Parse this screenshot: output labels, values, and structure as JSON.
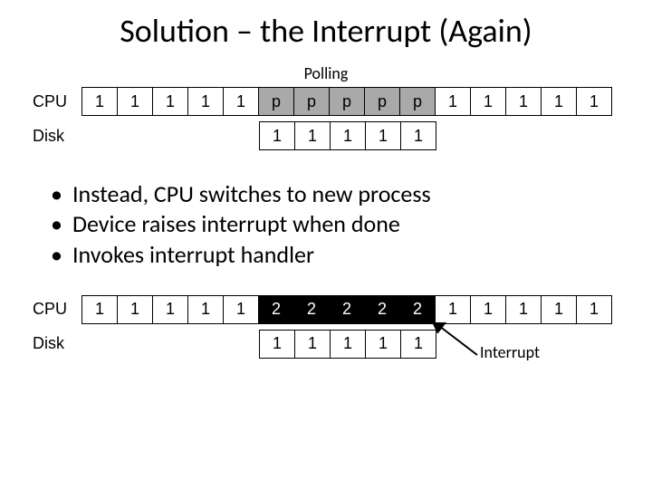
{
  "title": "Solution – the Interrupt (Again)",
  "polling_label": "Polling",
  "interrupt_label": "Interrupt",
  "timeline_polling": {
    "cpu_label": "CPU",
    "disk_label": "Disk",
    "cpu_cells": [
      {
        "t": "1",
        "s": ""
      },
      {
        "t": "1",
        "s": ""
      },
      {
        "t": "1",
        "s": ""
      },
      {
        "t": "1",
        "s": ""
      },
      {
        "t": "1",
        "s": ""
      },
      {
        "t": "p",
        "s": "grey"
      },
      {
        "t": "p",
        "s": "grey"
      },
      {
        "t": "p",
        "s": "grey"
      },
      {
        "t": "p",
        "s": "grey"
      },
      {
        "t": "p",
        "s": "grey"
      },
      {
        "t": "1",
        "s": ""
      },
      {
        "t": "1",
        "s": ""
      },
      {
        "t": "1",
        "s": ""
      },
      {
        "t": "1",
        "s": ""
      },
      {
        "t": "1",
        "s": ""
      }
    ],
    "disk_offset_cells": 5,
    "disk_cells": [
      {
        "t": "1",
        "s": ""
      },
      {
        "t": "1",
        "s": ""
      },
      {
        "t": "1",
        "s": ""
      },
      {
        "t": "1",
        "s": ""
      },
      {
        "t": "1",
        "s": ""
      }
    ]
  },
  "bullets": [
    "Instead, CPU switches to new process",
    "Device raises interrupt when done",
    "Invokes interrupt handler"
  ],
  "timeline_interrupt": {
    "cpu_label": "CPU",
    "disk_label": "Disk",
    "cpu_cells": [
      {
        "t": "1",
        "s": ""
      },
      {
        "t": "1",
        "s": ""
      },
      {
        "t": "1",
        "s": ""
      },
      {
        "t": "1",
        "s": ""
      },
      {
        "t": "1",
        "s": ""
      },
      {
        "t": "2",
        "s": "black"
      },
      {
        "t": "2",
        "s": "black"
      },
      {
        "t": "2",
        "s": "black"
      },
      {
        "t": "2",
        "s": "black"
      },
      {
        "t": "2",
        "s": "black"
      },
      {
        "t": "1",
        "s": ""
      },
      {
        "t": "1",
        "s": ""
      },
      {
        "t": "1",
        "s": ""
      },
      {
        "t": "1",
        "s": ""
      },
      {
        "t": "1",
        "s": ""
      }
    ],
    "disk_offset_cells": 5,
    "disk_cells": [
      {
        "t": "1",
        "s": ""
      },
      {
        "t": "1",
        "s": ""
      },
      {
        "t": "1",
        "s": ""
      },
      {
        "t": "1",
        "s": ""
      },
      {
        "t": "1",
        "s": ""
      }
    ]
  }
}
